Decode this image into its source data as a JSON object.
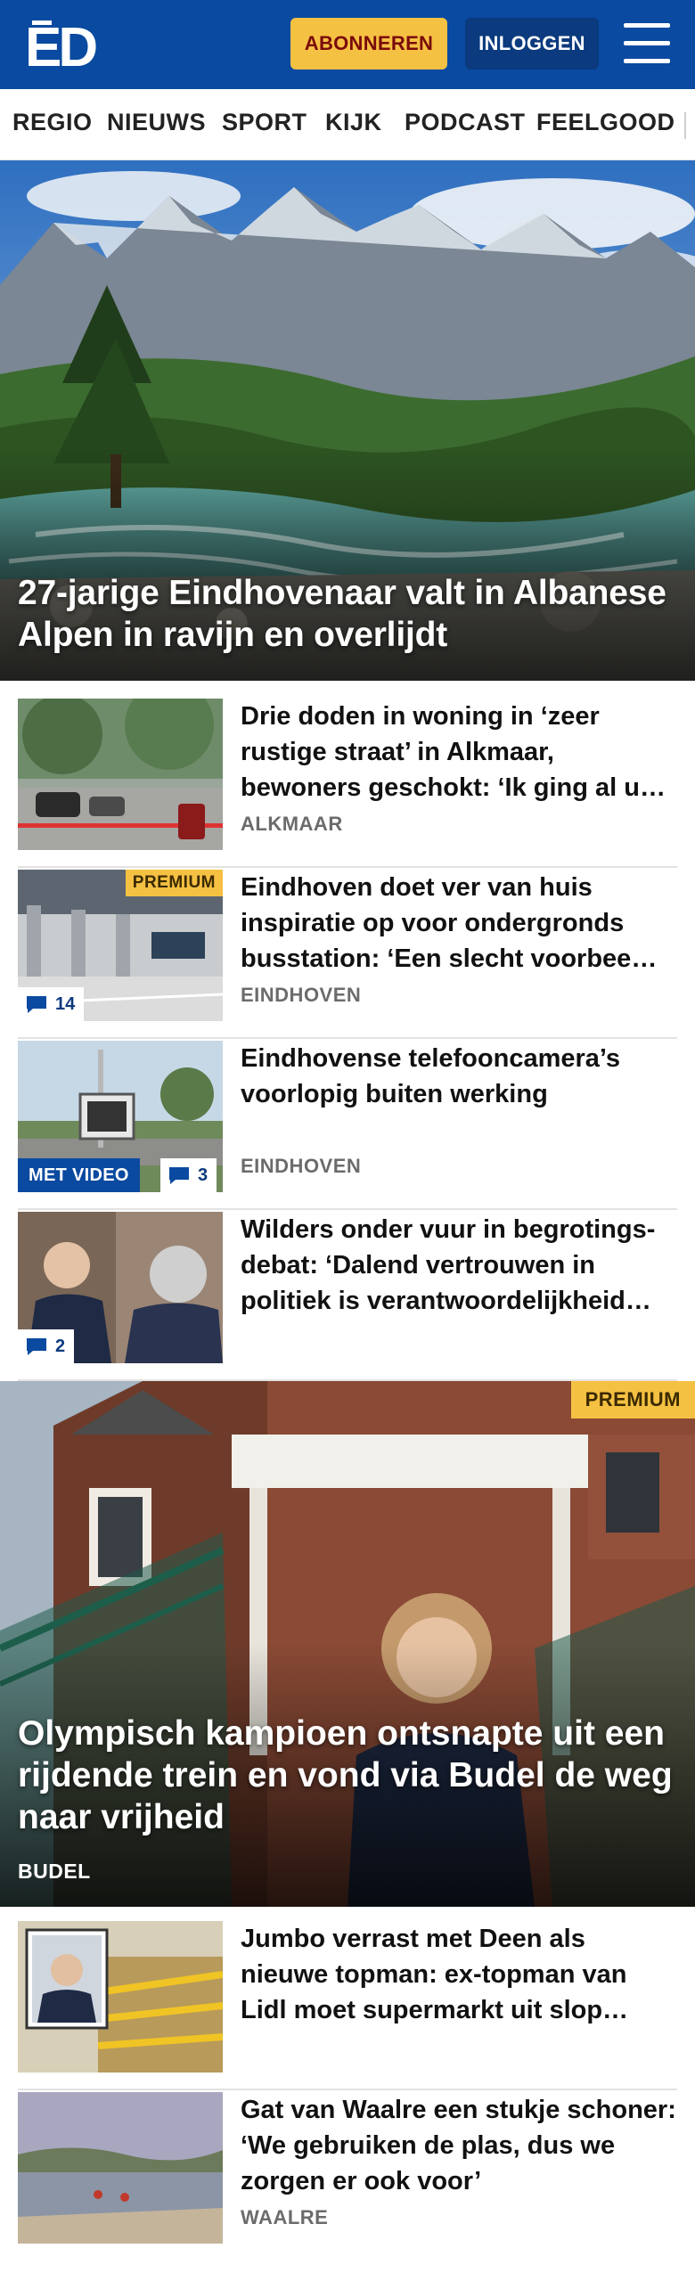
{
  "header": {
    "logo_text": "ED",
    "subscribe_label": "ABONNEREN",
    "login_label": "INLOGGEN",
    "menu_icon": "hamburger-menu-icon",
    "brand_color": "#0a4aa0",
    "accent_color": "#f5c142"
  },
  "nav": {
    "items": [
      "REGIO",
      "NIEUWS",
      "SPORT",
      "KIJK",
      "PODCAST",
      "FEELGOOD"
    ]
  },
  "hero": {
    "title": "27-jarige Eindhovenaar valt in Albanese Alpen in ravijn en overlijdt"
  },
  "articles": [
    {
      "title": "Drie doden in woning in ‘zeer rustige straat’ in Alkmaar, bewoners geschokt: ‘Ik ging al u…",
      "location": "ALKMAAR"
    },
    {
      "title": "Eindhoven doet ver van huis inspiratie op voor ondergronds busstation: ‘Een slecht voorbee…",
      "location": "EINDHOVEN",
      "badge": "PREMIUM",
      "comments": "14"
    },
    {
      "title": "Eindhovense telefooncamera’s voorlopig buiten werking",
      "location": "EINDHOVEN",
      "video_label": "MET VIDEO",
      "comments": "3"
    },
    {
      "title": "Wilders onder vuur in begrotings-debat: ‘Dalend vertrouwen in politiek is verantwoordelijkheid…",
      "comments": "2"
    }
  ],
  "featured": {
    "badge": "PREMIUM",
    "title": "Olympisch kampioen ontsnapte uit een rijdende trein en vond via Budel de weg naar vrijheid",
    "location": "BUDEL"
  },
  "more_articles": [
    {
      "title": "Jumbo verrast met Deen als nieuwe topman: ex-topman van Lidl moet supermarkt uit slop…"
    },
    {
      "title": "Gat van Waalre een stukje schoner: ‘We gebruiken de plas, dus we zorgen er ook voor’",
      "location": "WAALRE"
    }
  ]
}
